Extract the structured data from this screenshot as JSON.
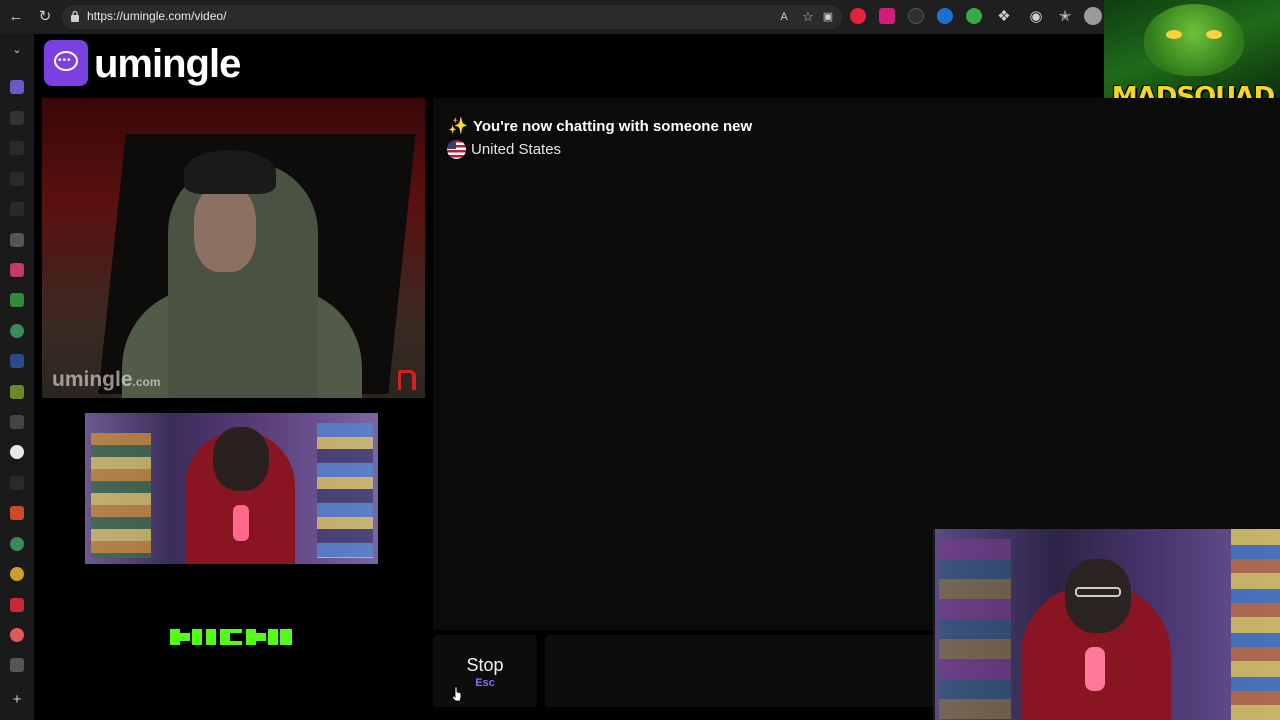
{
  "browser": {
    "url": "https://umingle.com/video/"
  },
  "site": {
    "logo_text": "umingle",
    "watermark_text": "umingle",
    "watermark_domain": ".com"
  },
  "overlay": {
    "brand_text": "MADSQUAD"
  },
  "chat": {
    "message_status": "You're now chatting with someone new",
    "message_country": "United States",
    "input_value": "",
    "input_placeholder": ""
  },
  "controls": {
    "stop_label": "Stop",
    "stop_shortcut": "Esc"
  },
  "colors": {
    "accent": "#7b3fe4",
    "shortcut": "#8a6cff",
    "kick_green": "#53fc18",
    "report_red": "#d42020"
  }
}
